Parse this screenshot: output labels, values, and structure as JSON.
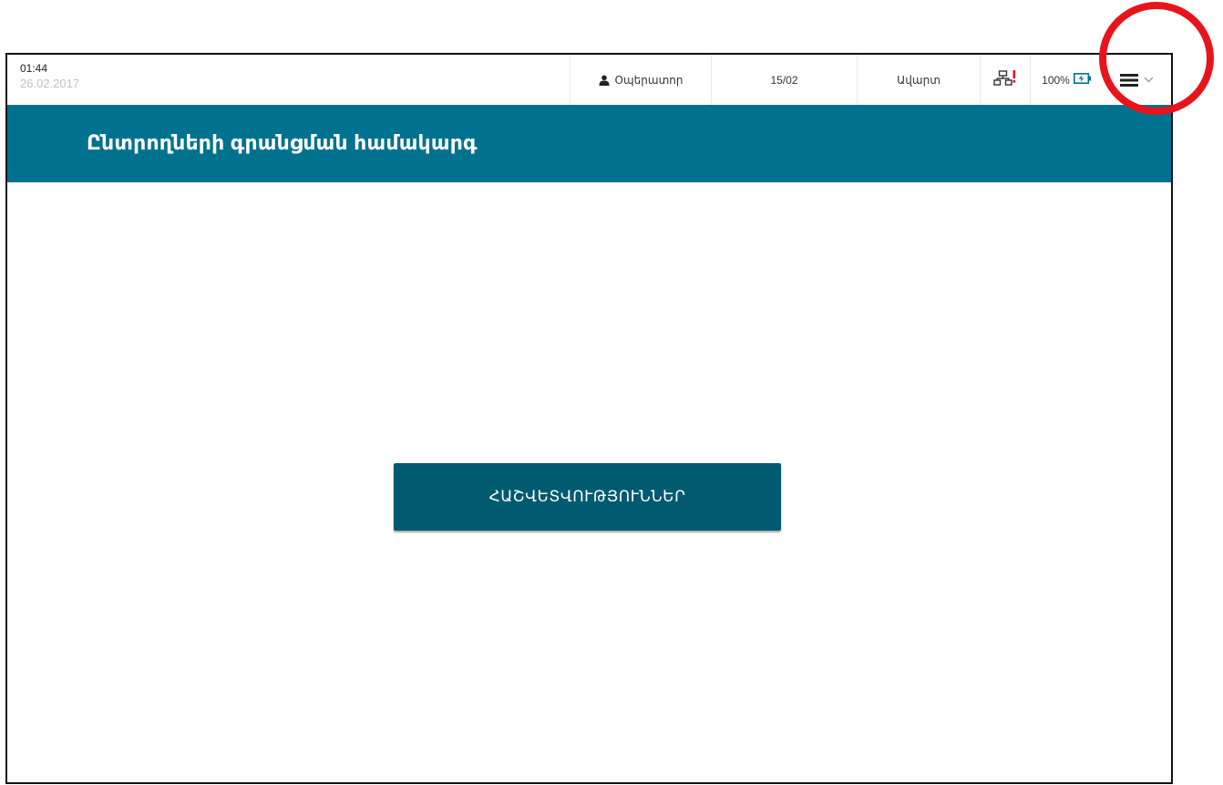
{
  "statusbar": {
    "time": "01:44",
    "date": "26.02.2017",
    "operator_label": "Օպերատոր",
    "count": "15/02",
    "finish_label": "Ավարտ",
    "battery": "100%",
    "icons": {
      "user": "user-icon",
      "network": "network-alert-icon",
      "battery": "battery-charging-icon",
      "menu": "hamburger-menu-icon",
      "chevron": "chevron-down-icon"
    }
  },
  "header": {
    "title": "Ընտրողների գրանցման համակարգ"
  },
  "main": {
    "reports_button": "ՀԱՇՎԵՏՎՈՒԹՅՈՒՆՆԵՐ"
  },
  "colors": {
    "header_bg": "#00728f",
    "button_bg": "#005a70",
    "annotation": "#e8141c",
    "alert": "#e8141c"
  }
}
